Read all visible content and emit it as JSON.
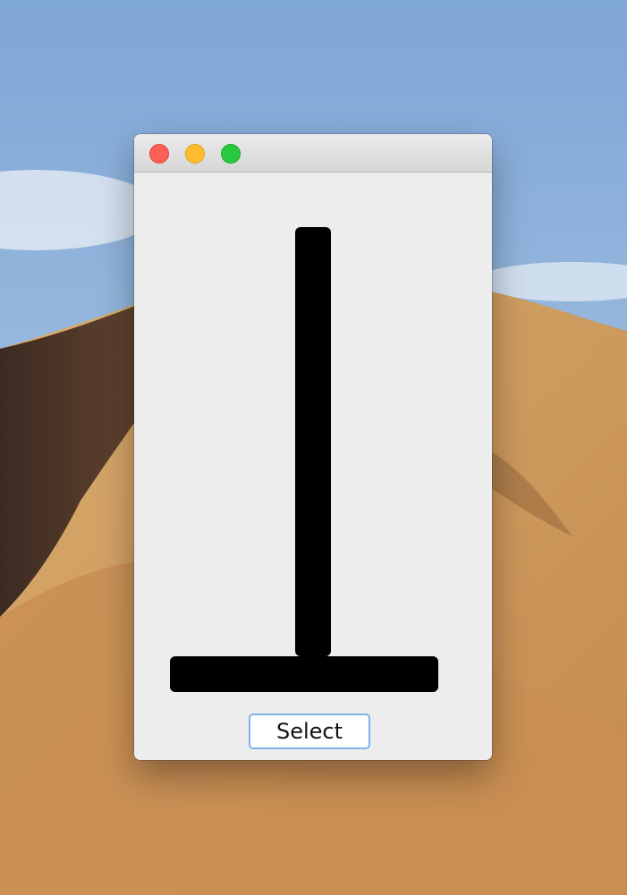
{
  "window": {
    "controls": {
      "close_icon": "close-traffic-light",
      "minimize_icon": "minimize-traffic-light",
      "maximize_icon": "maximize-traffic-light"
    }
  },
  "canvas": {
    "shape": "inverted-t",
    "color": "#000000"
  },
  "actions": {
    "select_label": "Select"
  },
  "colors": {
    "close": "#fe5f57",
    "minimize": "#febc2e",
    "maximize": "#28c840",
    "button_focus_ring": "#7fb4e8"
  }
}
